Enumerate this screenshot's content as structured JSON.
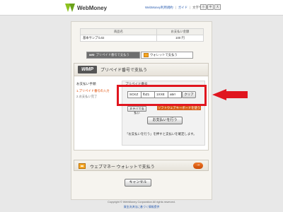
{
  "header": {
    "logo_text": "WebMoney",
    "links": [
      "WebMoney利用規約",
      "ガイド"
    ],
    "separator": "|",
    "font_size_label": "文字サイズ",
    "font_size_buttons": [
      "小",
      "中",
      "大"
    ]
  },
  "items_table": {
    "headers": [
      "商品名",
      "お支払い金額"
    ],
    "rows": [
      {
        "name": "基本サンプル02",
        "price": "100 円"
      }
    ]
  },
  "tabs": {
    "prepaid": {
      "logo": "wm",
      "label": "プリペイド番号で支払う"
    },
    "wallet": {
      "label": "ウォレットで支払う"
    }
  },
  "prepaid_section": {
    "badge": "WMP",
    "title": "プリペイド番号で支払う",
    "steps_heading": "お支払い手順",
    "steps": [
      "1.プリペイド番号の入力",
      "2.お支払い完了"
    ],
    "form_label": "プリペイド番号",
    "pin_values": [
      "SCKZ",
      "fbZ1",
      "1XXE",
      "a5rr"
    ],
    "clear_label": "クリア",
    "small_button_label": "ヌテバで支払い",
    "keyboard_link": "ソフトウェアキーボードを使う",
    "pay_button_label": "お支払いを行う",
    "note": "「お支払いを行う」を押すと支払いを確定します。"
  },
  "wallet_section": {
    "title": "ウェブマネー ウォレットで支払う",
    "arrow": "→"
  },
  "cancel_label": "キャンセル",
  "footer": {
    "copyright": "Copyright © WebMoney Corporation All rights reserved.",
    "link": "資金決済法に基づく情報提供"
  },
  "colors": {
    "highlight_red": "#e0161f",
    "link_blue": "#2a5db0",
    "accent_orange": "#d9621b"
  }
}
